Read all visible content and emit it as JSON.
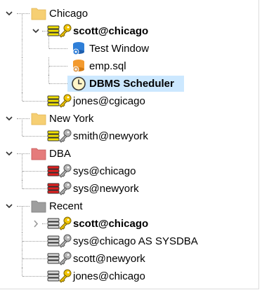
{
  "tree": {
    "groups": [
      {
        "label": "Chicago",
        "expanded": true,
        "folder_color": "#f6cf73",
        "folder_icon": "folder-icon",
        "children": [
          {
            "label": "scott@chicago",
            "bold": true,
            "expanded": true,
            "db_icon": "database-yellow-icon",
            "key_icon": "key-gold-icon",
            "children": [
              {
                "label": "Test Window",
                "icon": "test-window-icon"
              },
              {
                "label": "emp.sql",
                "icon": "sql-file-icon"
              },
              {
                "label": "DBMS Scheduler",
                "icon": "clock-icon",
                "selected": true,
                "bold": true
              }
            ]
          },
          {
            "label": "jones@cgicago",
            "db_icon": "database-yellow-icon",
            "key_icon": "key-gold-icon"
          }
        ]
      },
      {
        "label": "New York",
        "expanded": true,
        "folder_color": "#f6cf73",
        "folder_icon": "folder-icon",
        "children": [
          {
            "label": "smith@newyork",
            "db_icon": "database-yellow-icon",
            "key_icon": "key-gray-icon"
          }
        ]
      },
      {
        "label": "DBA",
        "expanded": true,
        "folder_color": "#e57b7b",
        "folder_icon": "folder-red-icon",
        "children": [
          {
            "label": "sys@chicago",
            "db_icon": "database-red-icon",
            "key_icon": "key-gray-icon"
          },
          {
            "label": "sys@newyork",
            "db_icon": "database-red-icon",
            "key_icon": "key-gray-icon"
          }
        ]
      },
      {
        "label": "Recent",
        "expanded": true,
        "folder_color": "#9e9e9e",
        "folder_icon": "folder-gray-icon",
        "children": [
          {
            "label": "scott@chicago",
            "bold": true,
            "collapsed": true,
            "db_icon": "database-gray-icon",
            "key_icon": "key-gold-icon"
          },
          {
            "label": "sys@chicago AS SYSDBA",
            "db_icon": "database-gray-icon",
            "key_icon": "key-gray-icon"
          },
          {
            "label": "scott@newyork",
            "db_icon": "database-gray-icon",
            "key_icon": "key-gray-icon"
          },
          {
            "label": "jones@chicago",
            "db_icon": "database-gray-icon",
            "key_icon": "key-gold-icon"
          }
        ]
      }
    ]
  },
  "colors": {
    "selection": "#cce8ff",
    "db_yellow": "#f2e100",
    "db_red": "#e02020",
    "db_gray": "#d8d8d8",
    "key_gold": "#f0c400",
    "key_gray": "#b5b5b5"
  }
}
